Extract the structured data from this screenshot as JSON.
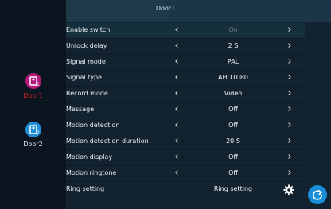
{
  "header": {
    "title": "Door1"
  },
  "doors": [
    {
      "label": "Door1",
      "icon": "door-bell-icon-1",
      "color": "#b3187a",
      "label_color": "#e02020"
    },
    {
      "label": "Door2",
      "icon": "door-bell-icon-2",
      "color": "#1e8ed8",
      "label_color": "#e8eef2"
    }
  ],
  "settings": [
    {
      "label": "Enable switch",
      "value": "On",
      "dim": true
    },
    {
      "label": "Unlock delay",
      "value": "2 S"
    },
    {
      "label": "Signal mode",
      "value": "PAL"
    },
    {
      "label": "Signal type",
      "value": "AHD1080"
    },
    {
      "label": "Record mode",
      "value": "Video"
    },
    {
      "label": "Message",
      "value": "Off"
    },
    {
      "label": "Motion detection",
      "value": "Off"
    },
    {
      "label": "Motion detection duration",
      "value": "20 S"
    },
    {
      "label": "Motion display",
      "value": "Off"
    },
    {
      "label": "Motion ringtone",
      "value": "Off"
    },
    {
      "label": "Ring setting",
      "value": "Ring setting"
    }
  ],
  "chevrons": {
    "left": "‹",
    "right": "›"
  },
  "colors": {
    "accent": "#1a8fd9",
    "door1": "#b3187a",
    "door2": "#1e8ed8"
  }
}
